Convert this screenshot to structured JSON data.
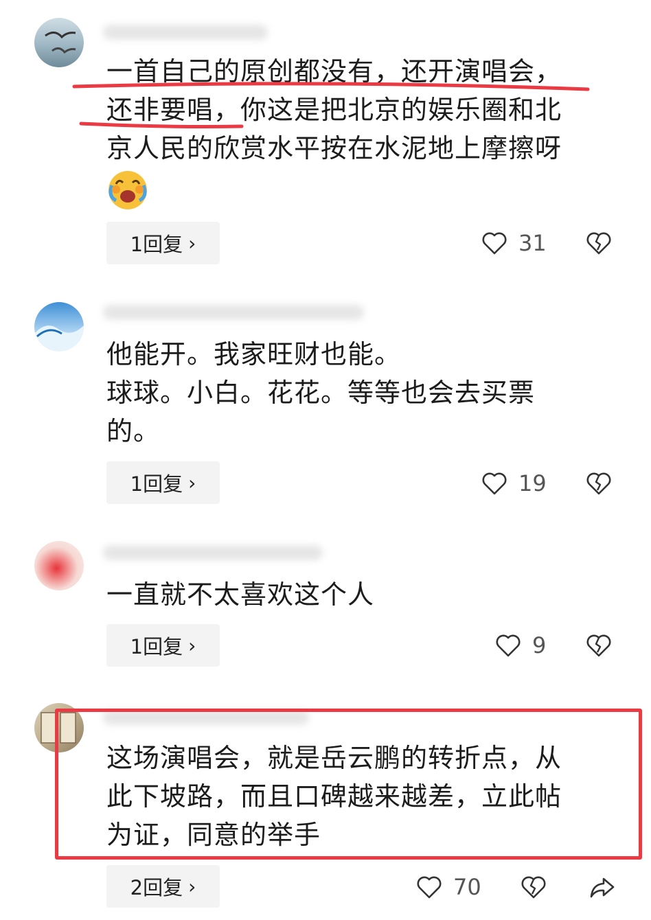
{
  "accent_red": "#ea3a43",
  "comments": [
    {
      "lines": [
        "一首自己的原创都没有，还开演唱会，",
        "还非要唱，你这是把北京的娱乐圈和北",
        "京人民的欣赏水平按在水泥地上摩擦呀"
      ],
      "emoji": "laugh-cry-emoji",
      "reply_label": "1回复",
      "likes": "31"
    },
    {
      "lines": [
        "他能开。我家旺财也能。",
        "球球。小白。花花。等等也会去买票",
        "的。"
      ],
      "reply_label": "1回复",
      "likes": "19"
    },
    {
      "lines": [
        "一直就不太喜欢这个人"
      ],
      "reply_label": "1回复",
      "likes": "9"
    },
    {
      "lines": [
        "这场演唱会，就是岳云鹏的转折点，从",
        "此下坡路，而且口碑越来越差，立此帖",
        "为证，同意的举手"
      ],
      "reply_label": "2回复",
      "likes": "70"
    }
  ],
  "chevron": "›"
}
